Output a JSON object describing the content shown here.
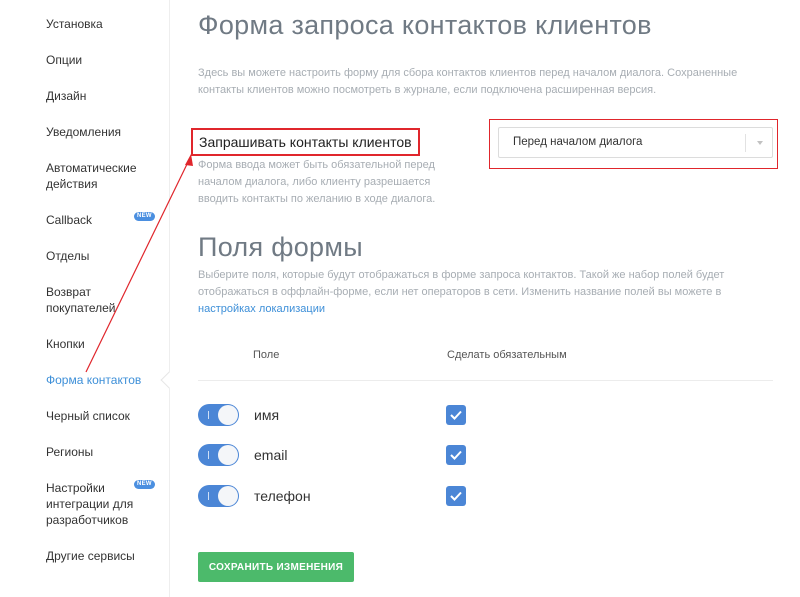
{
  "sidebar": {
    "items": [
      {
        "label": "Установка"
      },
      {
        "label": "Опции"
      },
      {
        "label": "Дизайн"
      },
      {
        "label": "Уведомления"
      },
      {
        "label": "Автоматические действия"
      },
      {
        "label": "Callback",
        "badge": "NEW"
      },
      {
        "label": "Отделы"
      },
      {
        "label": "Возврат покупателей"
      },
      {
        "label": "Кнопки"
      },
      {
        "label": "Форма контактов",
        "active": true
      },
      {
        "label": "Черный список"
      },
      {
        "label": "Регионы"
      },
      {
        "label": "Настройки интеграции для разработчиков",
        "badge": "NEW"
      },
      {
        "label": "Другие сервисы"
      }
    ]
  },
  "main": {
    "title": "Форма запроса контактов клиентов",
    "description": "Здесь вы можете настроить форму для сбора контактов клиентов перед началом диалога. Сохраненные контакты клиентов можно посмотреть в журнале, если подключена расширенная версия.",
    "ask_contacts": {
      "label": "Запрашивать контакты клиентов",
      "description": "Форма ввода может быть обязательной перед началом диалога, либо клиенту разрешается вводить контакты по желанию в ходе диалога.",
      "selected": "Перед началом диалога"
    },
    "fields_section": {
      "title": "Поля формы",
      "description": "Выберите поля, которые будут отображаться в форме запроса контактов. Такой же набор полей будет отображаться в оффлайн-форме, если нет операторов в сети. Изменить название полей вы можете в ",
      "link": "настройках локализации",
      "col_field": "Поле",
      "col_required": "Сделать обязательным",
      "fields": [
        {
          "name": "имя",
          "enabled": true,
          "required": true
        },
        {
          "name": "email",
          "enabled": true,
          "required": true
        },
        {
          "name": "телефон",
          "enabled": true,
          "required": true
        }
      ]
    },
    "save_label": "СОХРАНИТЬ ИЗМЕНЕНИЯ"
  },
  "colors": {
    "accent": "#4b86d6",
    "link": "#3d8fd8",
    "save": "#4cba6b",
    "highlight": "#e0262c"
  }
}
